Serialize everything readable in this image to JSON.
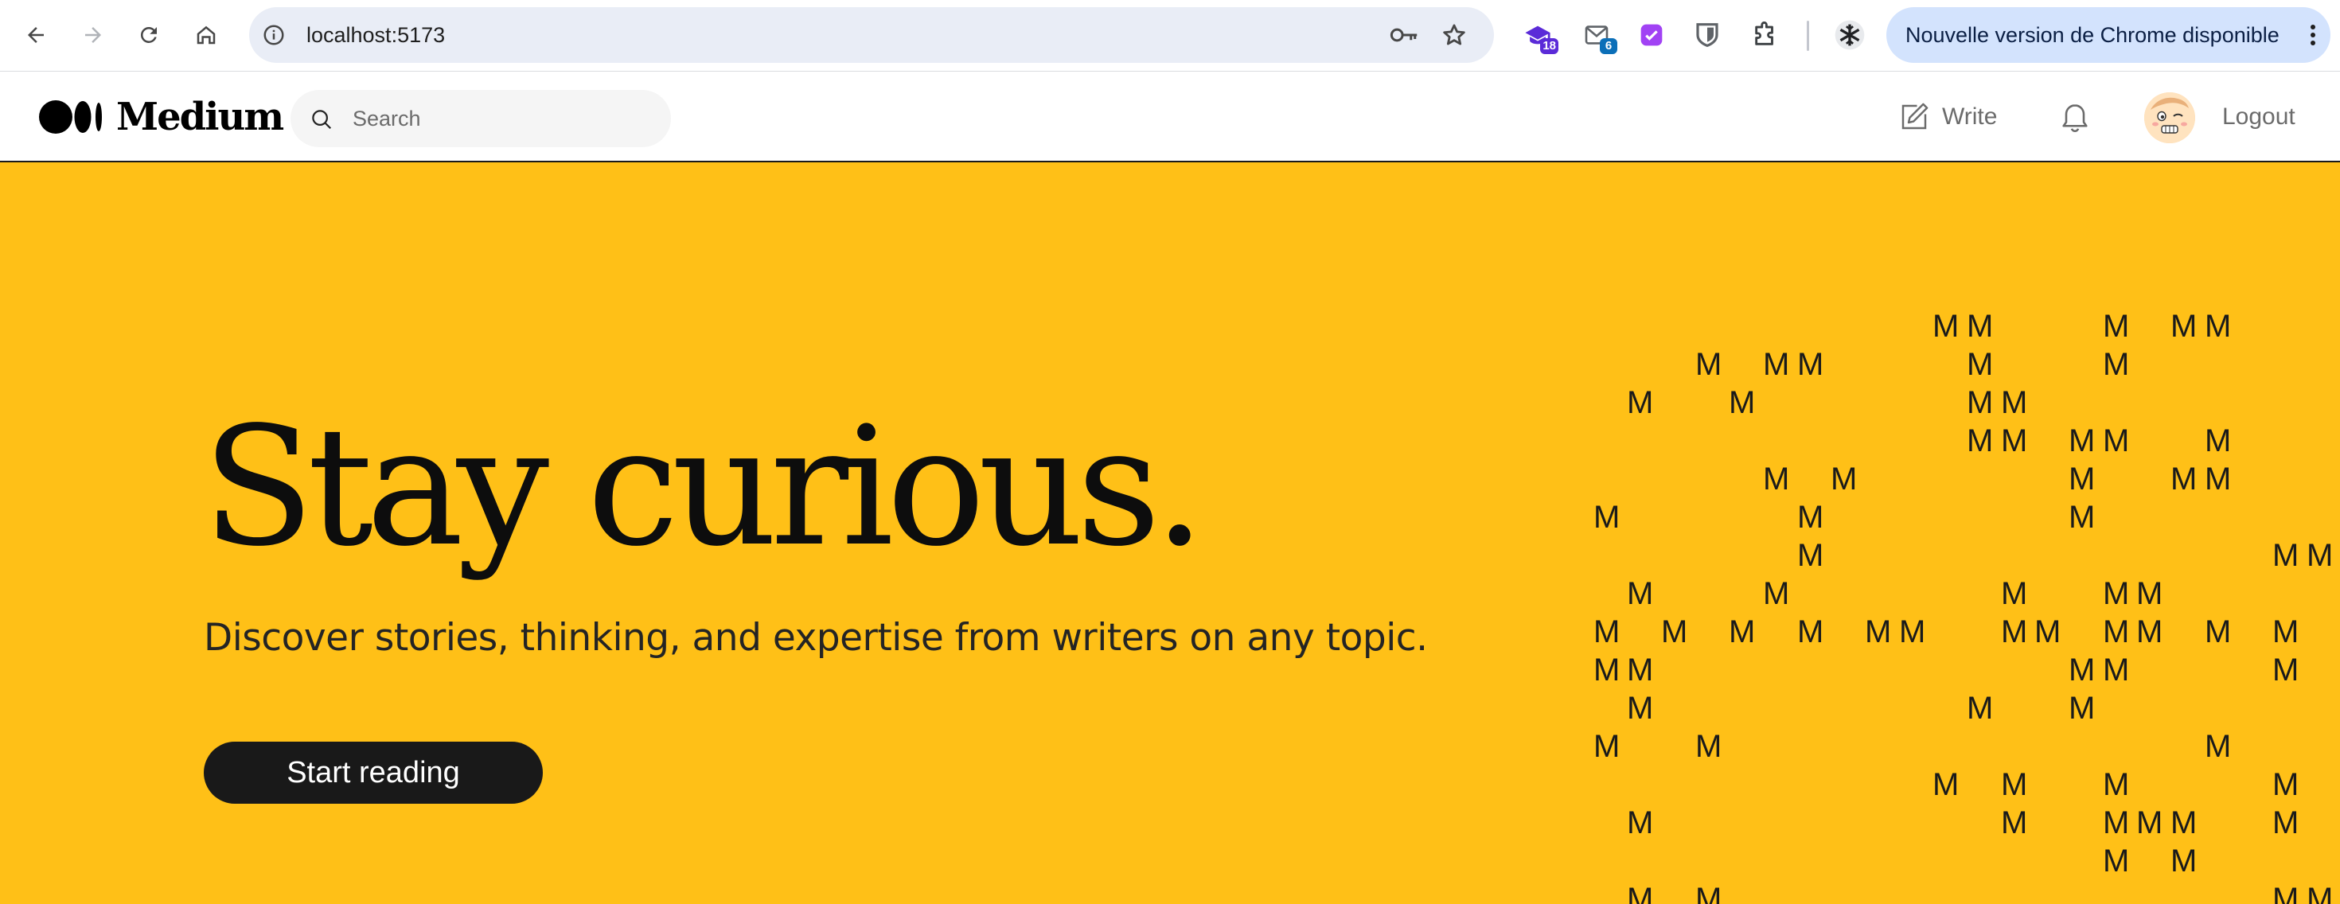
{
  "browser": {
    "url": "localhost:5173",
    "extensions": [
      {
        "name": "graduation-cap-extension-icon",
        "badge": "18",
        "color": "#5b2bd8"
      },
      {
        "name": "mail-extension-icon",
        "badge": "6",
        "color": "#1a73e8"
      },
      {
        "name": "purple-check-extension-icon",
        "badge": "",
        "color": "#a142f4"
      },
      {
        "name": "bitwarden-extension-icon",
        "badge": "",
        "color": "#5f6368"
      },
      {
        "name": "puzzle-extensions-icon",
        "badge": "",
        "color": "#3c4043"
      },
      {
        "name": "snowflake-profile-icon",
        "badge": "",
        "color": "#202124"
      }
    ],
    "update_text": "Nouvelle version de Chrome disponible"
  },
  "header": {
    "logo_text": "Medium",
    "search_placeholder": "Search",
    "search_value": "",
    "write_label": "Write",
    "logout_label": "Logout"
  },
  "hero": {
    "title": "Stay curious.",
    "subtitle": "Discover stories, thinking, and expertise from writers on any topic.",
    "cta_label": "Start reading",
    "background": "#ffc017",
    "pattern_glyph": "M"
  }
}
